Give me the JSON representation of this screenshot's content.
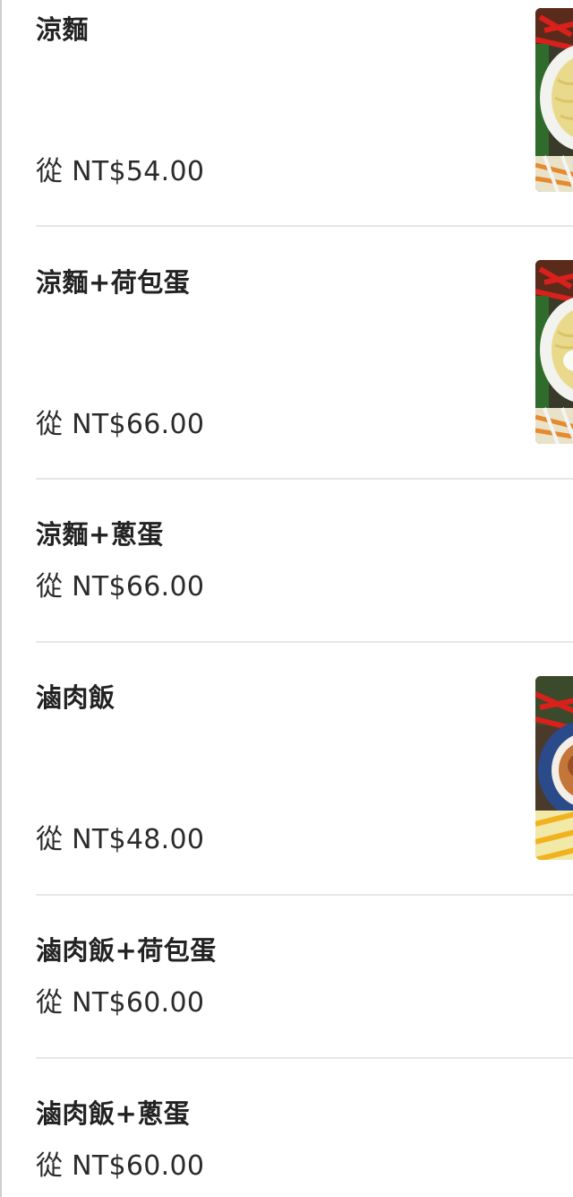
{
  "menu": {
    "items": [
      {
        "name": "涼麵",
        "price": "從 NT$54.00",
        "has_image": true,
        "image_icon": "cold-noodles-photo"
      },
      {
        "name": "涼麵+荷包蛋",
        "price": "從 NT$66.00",
        "has_image": true,
        "image_icon": "cold-noodles-egg-photo"
      },
      {
        "name": "涼麵+蔥蛋",
        "price": "從 NT$66.00",
        "has_image": false
      },
      {
        "name": "滷肉飯",
        "price": "從 NT$48.00",
        "has_image": true,
        "image_icon": "braised-pork-rice-photo"
      },
      {
        "name": "滷肉飯+荷包蛋",
        "price": "從 NT$60.00",
        "has_image": false
      },
      {
        "name": "滷肉飯+蔥蛋",
        "price": "從 NT$60.00",
        "has_image": false
      }
    ]
  }
}
